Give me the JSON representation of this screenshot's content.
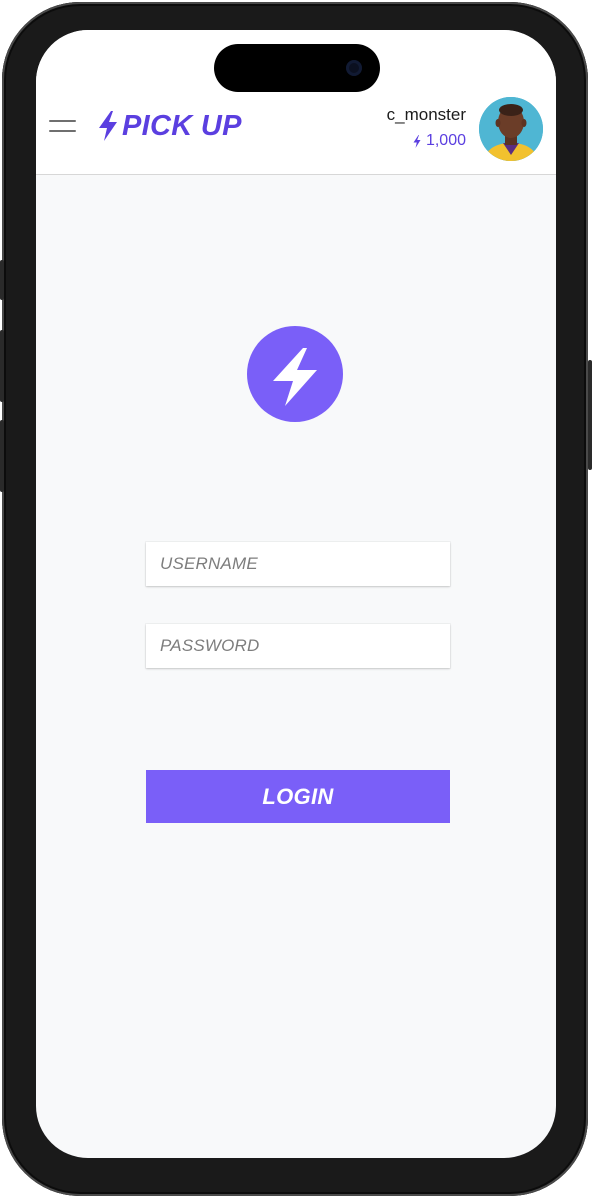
{
  "header": {
    "app_name": "PICK UP",
    "menu_icon": "hamburger-menu-icon",
    "logo_icon": "lightning-bolt-icon"
  },
  "user": {
    "username": "c_monster",
    "credits": "1,000",
    "credits_icon": "lightning-bolt-icon",
    "avatar": "avatar-photo"
  },
  "login_form": {
    "logo_icon": "lightning-bolt-icon",
    "username_placeholder": "USERNAME",
    "password_placeholder": "PASSWORD",
    "login_label": "LOGIN"
  },
  "colors": {
    "brand": "#5b3fe0",
    "accent": "#7a5ff8",
    "background": "#f8f9fa",
    "header_bg": "#ffffff"
  }
}
